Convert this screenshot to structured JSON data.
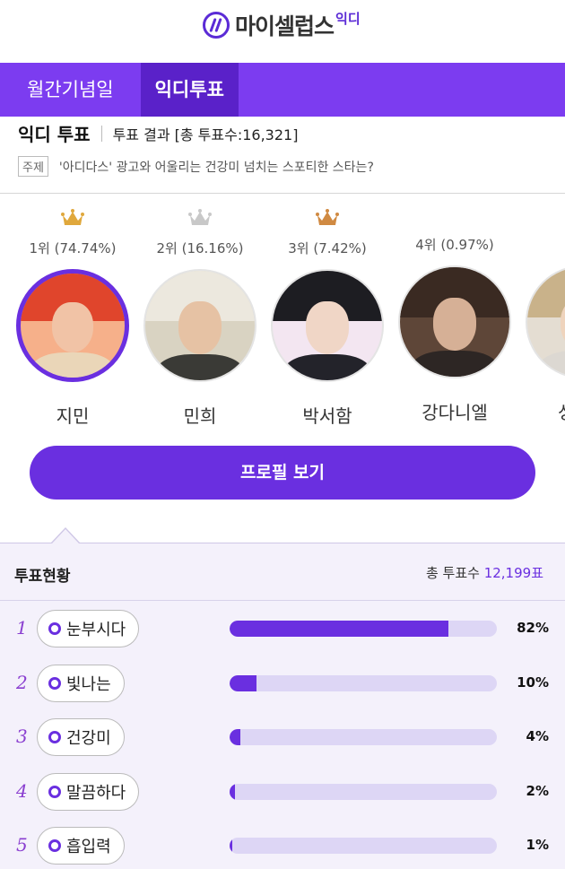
{
  "header": {
    "logo_text": "마이셀럽스",
    "logo_sub": "익디"
  },
  "nav": {
    "tabs": [
      {
        "label": "월간기념일"
      },
      {
        "label": "익디투표"
      }
    ]
  },
  "poll": {
    "title": "익디 투표",
    "result_label": "투표 결과 [총 투표수:16,321]",
    "subject_tag": "주제",
    "subject": "'아디다스' 광고와 어울리는 건강미 넘치는 스포티한 스타는?"
  },
  "candidates": [
    {
      "rank": "1위 (74.74%)",
      "name": "지민",
      "crown": "gold-crown-icon"
    },
    {
      "rank": "2위 (16.16%)",
      "name": "민희",
      "crown": "silver-crown-icon"
    },
    {
      "rank": "3위 (7.42%)",
      "name": "박서함",
      "crown": "bronze-crown-icon"
    },
    {
      "rank": "4위 (0.97%)",
      "name": "강다니엘"
    },
    {
      "name": "성"
    }
  ],
  "profile_button": "프로필 보기",
  "vote_status": {
    "title": "투표현황",
    "total_label": "총 투표수",
    "total_value": "12,199표",
    "rows": [
      {
        "rank": "1",
        "label": "눈부시다",
        "percent": 82,
        "percent_label": "82%"
      },
      {
        "rank": "2",
        "label": "빛나는",
        "percent": 10,
        "percent_label": "10%"
      },
      {
        "rank": "3",
        "label": "건강미",
        "percent": 4,
        "percent_label": "4%"
      },
      {
        "rank": "4",
        "label": "말끔하다",
        "percent": 2,
        "percent_label": "2%"
      },
      {
        "rank": "5",
        "label": "흡입력",
        "percent": 1,
        "percent_label": "1%"
      }
    ]
  },
  "colors": {
    "accent": "#6a2fe0",
    "nav_bg": "#7c3cf0",
    "nav_active": "#5a21c9",
    "gold": "#e0a83c",
    "silver": "#c8c8c8",
    "bronze": "#d08a42"
  }
}
